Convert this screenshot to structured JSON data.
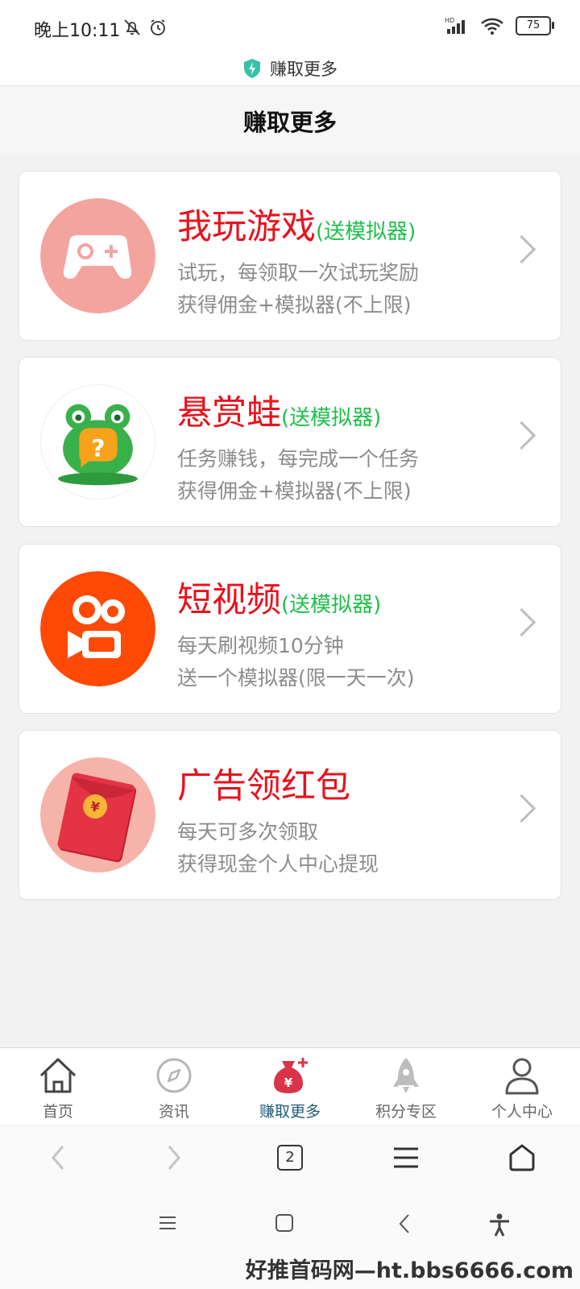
{
  "status": {
    "time": "晚上10:11",
    "battery": "75",
    "network": "HD"
  },
  "browser": {
    "title": "赚取更多",
    "tab_count": "2"
  },
  "page": {
    "header": "赚取更多"
  },
  "cards": [
    {
      "title": "我玩游戏",
      "tag": "(送模拟器)",
      "line1": "试玩，每领取一次试玩奖励",
      "line2": "获得佣金+模拟器(不上限)",
      "icon": "gamepad-icon"
    },
    {
      "title": "悬赏蛙",
      "tag": "(送模拟器)",
      "line1": "任务赚钱，每完成一个任务",
      "line2": "获得佣金+模拟器(不上限)",
      "icon": "frog-icon"
    },
    {
      "title": "短视频",
      "tag": "(送模拟器)",
      "line1": "每天刷视频10分钟",
      "line2": "送一个模拟器(限一天一次)",
      "icon": "kuaishou-icon"
    },
    {
      "title": "广告领红包",
      "tag": "",
      "line1": "每天可多次领取",
      "line2": "获得现金个人中心提现",
      "icon": "red-envelope-icon"
    }
  ],
  "tabs": [
    {
      "label": "首页",
      "icon": "home-icon"
    },
    {
      "label": "资讯",
      "icon": "compass-icon"
    },
    {
      "label": "赚取更多",
      "icon": "money-bag-icon",
      "active": true
    },
    {
      "label": "积分专区",
      "icon": "rocket-icon"
    },
    {
      "label": "个人中心",
      "icon": "user-icon"
    }
  ],
  "watermark": "好推首码网—ht.bbs6666.com",
  "colors": {
    "title_red": "#e8121c",
    "tag_green": "#1fbf4a",
    "active_tab": "#1f5b77",
    "accent_red": "#d9344a"
  }
}
